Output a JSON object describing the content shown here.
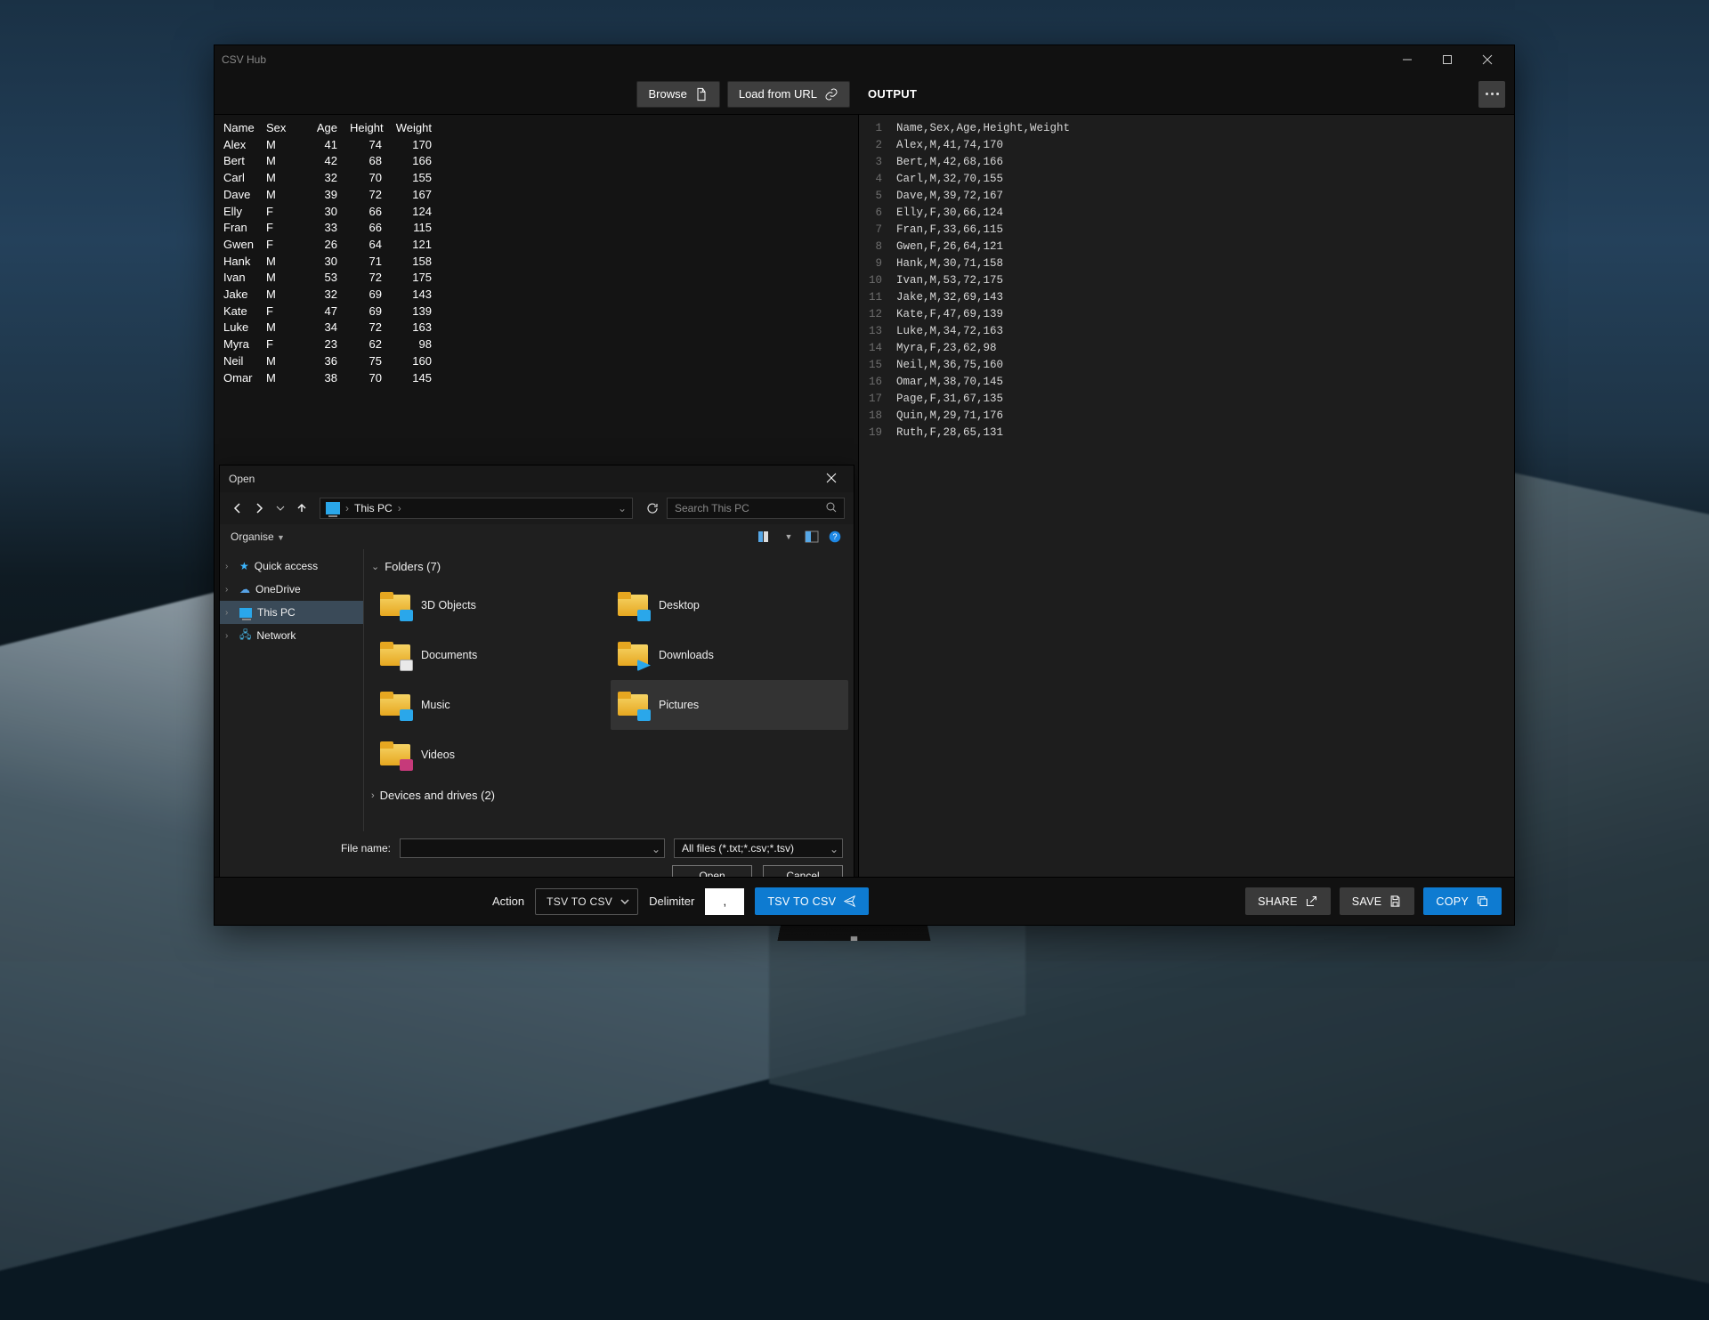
{
  "app_title": "CSV Hub",
  "toolbar": {
    "browse": "Browse",
    "load_url": "Load from URL",
    "output_label": "OUTPUT"
  },
  "table": {
    "headers": [
      "Name",
      "Sex",
      "Age",
      "Height",
      "Weight"
    ],
    "rows": [
      [
        "Alex",
        "M",
        "41",
        "74",
        "170"
      ],
      [
        "Bert",
        "M",
        "42",
        "68",
        "166"
      ],
      [
        "Carl",
        "M",
        "32",
        "70",
        "155"
      ],
      [
        "Dave",
        "M",
        "39",
        "72",
        "167"
      ],
      [
        "Elly",
        "F",
        "30",
        "66",
        "124"
      ],
      [
        "Fran",
        "F",
        "33",
        "66",
        "115"
      ],
      [
        "Gwen",
        "F",
        "26",
        "64",
        "121"
      ],
      [
        "Hank",
        "M",
        "30",
        "71",
        "158"
      ],
      [
        "Ivan",
        "M",
        "53",
        "72",
        "175"
      ],
      [
        "Jake",
        "M",
        "32",
        "69",
        "143"
      ],
      [
        "Kate",
        "F",
        "47",
        "69",
        "139"
      ],
      [
        "Luke",
        "M",
        "34",
        "72",
        "163"
      ],
      [
        "Myra",
        "F",
        "23",
        "62",
        "98"
      ],
      [
        "Neil",
        "M",
        "36",
        "75",
        "160"
      ],
      [
        "Omar",
        "M",
        "38",
        "70",
        "145"
      ]
    ]
  },
  "output_lines": [
    "Name,Sex,Age,Height,Weight",
    "Alex,M,41,74,170",
    "Bert,M,42,68,166",
    "Carl,M,32,70,155",
    "Dave,M,39,72,167",
    "Elly,F,30,66,124",
    "Fran,F,33,66,115",
    "Gwen,F,26,64,121",
    "Hank,M,30,71,158",
    "Ivan,M,53,72,175",
    "Jake,M,32,69,143",
    "Kate,F,47,69,139",
    "Luke,M,34,72,163",
    "Myra,F,23,62,98",
    "Neil,M,36,75,160",
    "Omar,M,38,70,145",
    "Page,F,31,67,135",
    "Quin,M,29,71,176",
    "Ruth,F,28,65,131"
  ],
  "bottom": {
    "action_label": "Action",
    "action_value": "TSV TO CSV",
    "delimiter_label": "Delimiter",
    "delimiter_value": ",",
    "run_label": "TSV TO CSV",
    "share": "SHARE",
    "save": "SAVE",
    "copy": "COPY"
  },
  "dialog": {
    "title": "Open",
    "location": "This PC",
    "search_placeholder": "Search This PC",
    "organise": "Organise",
    "tree": {
      "quick": "Quick access",
      "onedrive": "OneDrive",
      "thispc": "This PC",
      "network": "Network"
    },
    "folders_heading": "Folders (7)",
    "drives_heading": "Devices and drives (2)",
    "folders": [
      "3D Objects",
      "Desktop",
      "Documents",
      "Downloads",
      "Music",
      "Pictures",
      "Videos"
    ],
    "filename_label": "File name:",
    "filename_value": "",
    "filter": "All files (*.txt;*.csv;*.tsv)",
    "open": "Open",
    "cancel": "Cancel"
  }
}
